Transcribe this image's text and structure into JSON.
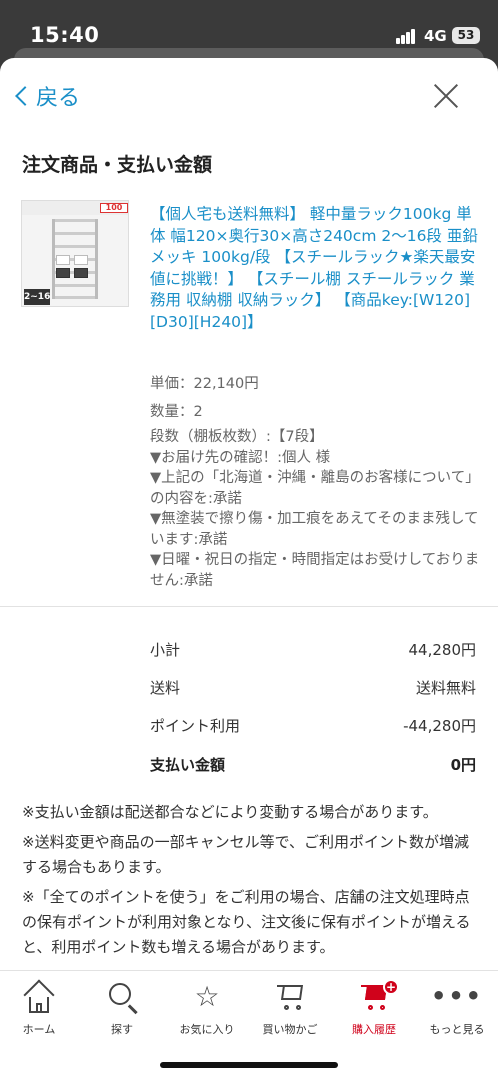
{
  "status_bar": {
    "time": "15:40",
    "network": "4G",
    "battery": "53"
  },
  "header": {
    "back_label": "戻る"
  },
  "section_title": "注文商品・支払い金額",
  "product": {
    "thumb_tag": "100",
    "thumb_label": "2~16段",
    "title": "【個人宅も送料無料】 軽中量ラック100kg 単体 幅120×奥行30×高さ240cm 2～16段 亜鉛メッキ 100kg/段 【スチールラック★楽天最安値に挑戦！】 【スチール棚 スチールラック 業務用 収納棚 収納ラック】 【商品key:[W120][D30][H240]】",
    "unit_price": "単価：22,140円",
    "quantity": "数量：2",
    "options": [
      "段数（棚板枚数）:【7段】",
      "▼お届け先の確認！:個人 様",
      "▼上記の「北海道・沖縄・離島のお客様について」の内容を:承諾",
      "▼無塗装で擦り傷・加工痕をあえてそのまま残しています:承諾",
      "▼日曜・祝日の指定・時間指定はお受けしておりません:承諾"
    ]
  },
  "summary": [
    {
      "label": "小計",
      "value": "44,280円"
    },
    {
      "label": "送料",
      "value": "送料無料"
    },
    {
      "label": "ポイント利用",
      "value": "-44,280円"
    },
    {
      "label": "支払い金額",
      "value": "0円"
    }
  ],
  "notes": [
    "※支払い金額は配送都合などにより変動する場合があります。",
    "※送料変更や商品の一部キャンセル等で、ご利用ポイント数が増減する場合もあります。",
    "※「全てのポイントを使う」をご利用の場合、店舗の注文処理時点の保有ポイントが利用対象となり、注文後に保有ポイントが増えると、利用ポイント数も増える場合があります。"
  ],
  "tabbar": {
    "items": [
      {
        "label": "ホーム",
        "icon": "home-icon"
      },
      {
        "label": "探す",
        "icon": "search-icon"
      },
      {
        "label": "お気に入り",
        "icon": "star-icon"
      },
      {
        "label": "買い物かご",
        "icon": "cart-icon"
      },
      {
        "label": "購入履歴",
        "icon": "purchase-history-icon"
      },
      {
        "label": "もっと見る",
        "icon": "more-icon"
      }
    ],
    "active_color": "#d0021b",
    "star_glyph": "☆",
    "more_glyph": "•••"
  },
  "colors": {
    "link": "#1a8fc8",
    "accent": "#d0021b"
  }
}
